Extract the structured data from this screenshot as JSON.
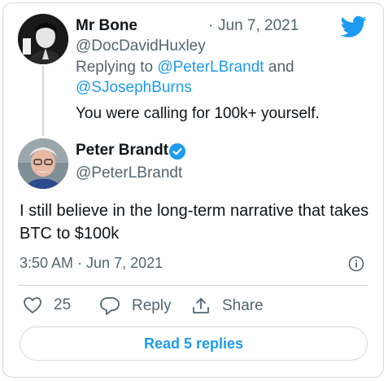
{
  "reply_tweet": {
    "author_name": "Mr Bone",
    "handle": "@DocDavidHuxley",
    "date_separator": "·",
    "date": "Jun 7, 2021",
    "replying_to_label": "Replying to",
    "replying_to_user1": "@PeterLBrandt",
    "replying_and": "and",
    "replying_to_user2": "@SJosephBurns",
    "text": "You were calling for 100k+ yourself."
  },
  "main_tweet": {
    "author_name": "Peter Brandt",
    "handle": "@PeterLBrandt",
    "text": "I still believe in the long-term narrative that takes BTC to $100k",
    "timestamp": "3:50 AM · Jun 7, 2021"
  },
  "actions": {
    "like_count": "25",
    "reply_label": "Reply",
    "share_label": "Share"
  },
  "read_replies_label": "Read 5 replies",
  "icons": {
    "brand": "twitter-bird-icon",
    "verified": "verified-badge-icon",
    "info": "info-icon",
    "like": "heart-icon",
    "reply": "speech-bubble-icon",
    "share": "share-arrow-icon"
  },
  "colors": {
    "accent": "#1d9bf0",
    "muted": "#536471",
    "border": "#cfd9de"
  }
}
